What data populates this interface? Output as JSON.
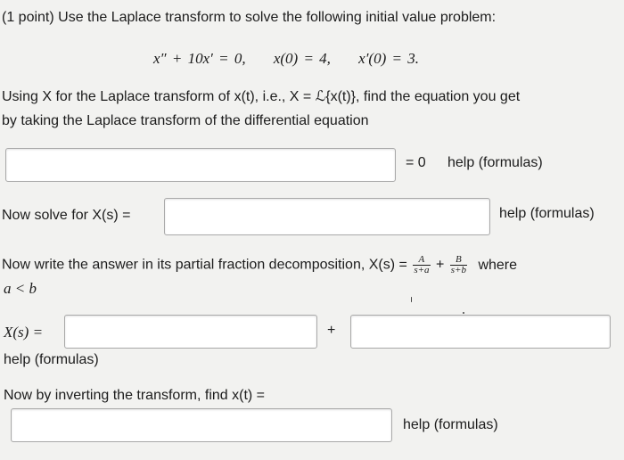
{
  "problem": {
    "intro": "(1 point) Use the Laplace transform to solve the following initial value problem:",
    "equation": "x″ + 10x′ = 0,     x(0) = 4,     x′(0) = 3.",
    "line1": "Using X for the Laplace transform of x(t), i.e., X = ℒ{x(t)}, find the equation you get",
    "line2": "by taking the Laplace transform of the differential equation"
  },
  "step1": {
    "equals": "= 0",
    "help": "help (formulas)"
  },
  "step2": {
    "label": "Now solve for X(s) =",
    "help": "help (formulas)"
  },
  "step3": {
    "text": "Now write the answer in its partial fraction decomposition, X(s) =",
    "frac1_num": "A",
    "frac1_den": "s+a",
    "plus": "+",
    "frac2_num": "B",
    "frac2_den": "s+b",
    "where": "where",
    "condition": "a < b"
  },
  "step4": {
    "label": "X(s) =",
    "plus": "+",
    "help": "help (formulas)"
  },
  "step5": {
    "label": "Now by inverting the transform, find x(t) =",
    "help": "help (formulas)"
  }
}
